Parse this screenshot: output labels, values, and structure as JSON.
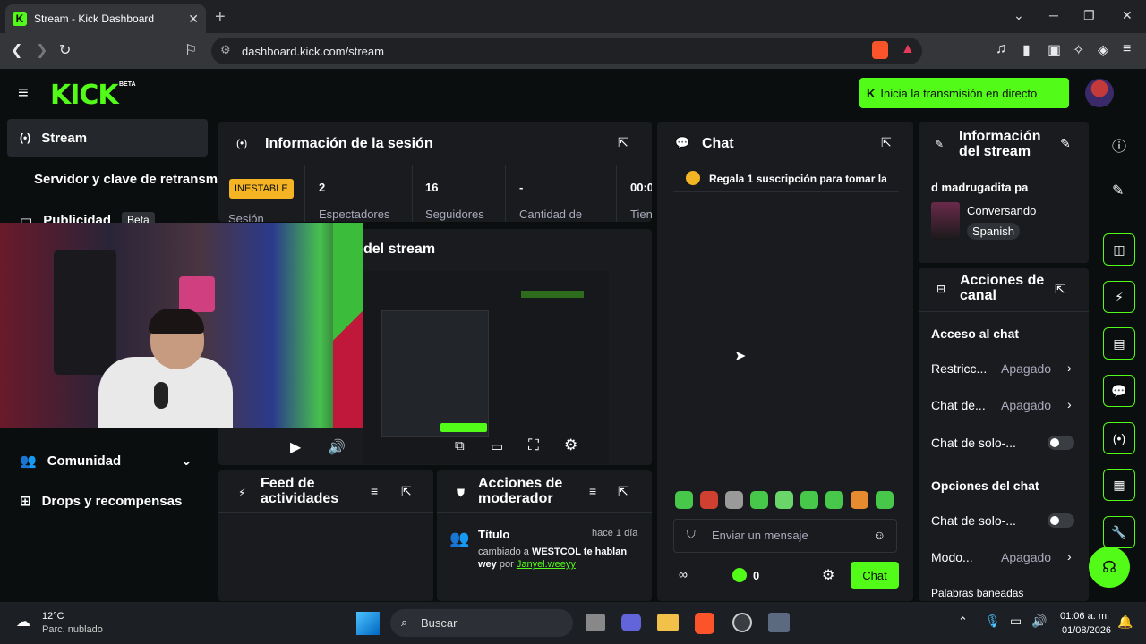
{
  "browser": {
    "tab_title": "Stream - Kick Dashboard",
    "url": "dashboard.kick.com/stream"
  },
  "header": {
    "logo": "KICK",
    "logo_badge": "BETA",
    "go_live_label": "Inicia la transmisión en directo"
  },
  "sidebar": {
    "stream": "Stream",
    "server_keys": "Servidor y clave de retransm",
    "ads": "Publicidad",
    "ads_badge": "Beta",
    "community": "Comunidad",
    "drops": "Drops y recompensas"
  },
  "session": {
    "title": "Información de la sesión",
    "status_badge": "INESTABLE",
    "status_label": "Sesión",
    "stats": [
      {
        "value": "2",
        "label": "Espectadores"
      },
      {
        "value": "16",
        "label": "Seguidores"
      },
      {
        "value": "-",
        "label": "Cantidad de"
      },
      {
        "value": "00:0",
        "label": "Tien"
      }
    ]
  },
  "stream_preview": {
    "title_fragment": "del stream"
  },
  "activity_feed": {
    "title": "Feed de actividades"
  },
  "mod_actions": {
    "title": "Acciones de moderador",
    "item": {
      "title": "Título",
      "time": "hace 1 día",
      "changed_to": "cambiado a",
      "new_title": "WESTCOL te hablan wey",
      "by": "por",
      "user": "Janyel.weeyy"
    }
  },
  "chat": {
    "title": "Chat",
    "pinned": "Regala 1 suscripción para tomar la",
    "input_placeholder": "Enviar un mensaje",
    "points": "0",
    "send_label": "Chat"
  },
  "stream_info": {
    "title": "Información del stream",
    "stream_title": "d madrugadita pa",
    "category": "Conversando",
    "language": "Spanish"
  },
  "channel_actions": {
    "title": "Acciones de canal",
    "chat_access_heading": "Acceso al chat",
    "rows": [
      {
        "label": "Restricc...",
        "value": "Apagado"
      },
      {
        "label": "Chat de...",
        "value": "Apagado"
      },
      {
        "label": "Chat de solo-...",
        "value": ""
      }
    ],
    "chat_options_heading": "Opciones del chat",
    "option_rows": [
      {
        "label": "Chat de solo-...",
        "value": ""
      },
      {
        "label": "Modo...",
        "value": "Apagado"
      },
      {
        "label": "Palabras baneadas",
        "value": ""
      }
    ]
  },
  "taskbar": {
    "temp": "12°C",
    "weather": "Parc. nublado",
    "search": "Buscar",
    "time": "01:06 a. m.",
    "date": "01/08/2026"
  },
  "colors": {
    "brand": "#53fc18",
    "badge": "#f5b423",
    "panel": "#191b1f"
  }
}
